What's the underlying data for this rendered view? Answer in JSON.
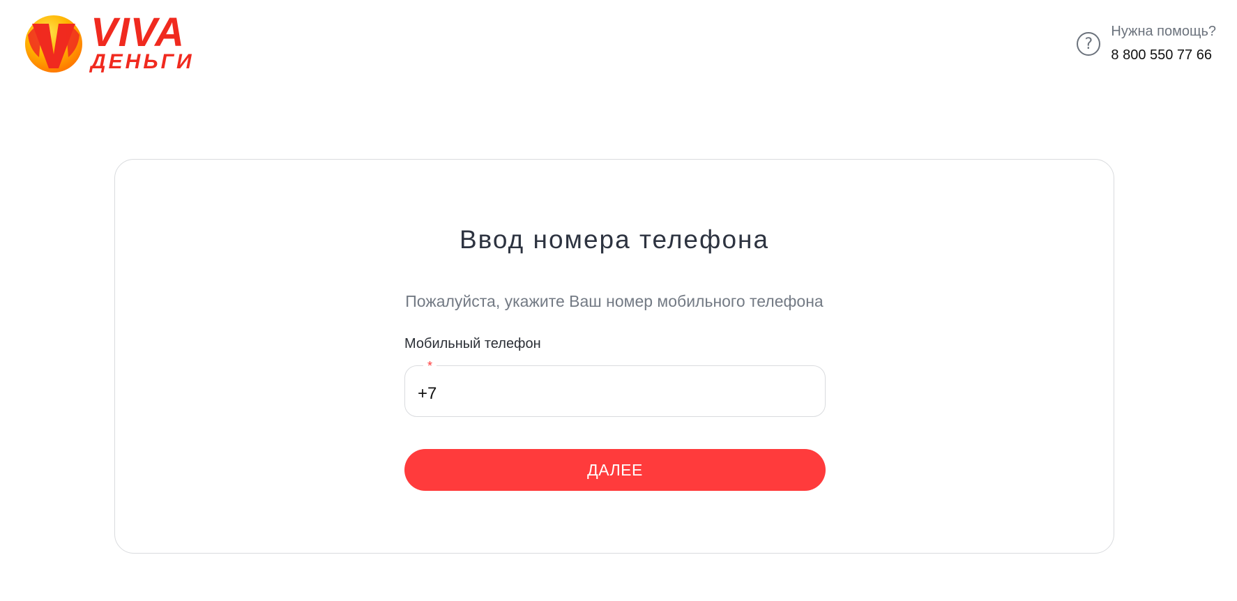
{
  "brand": {
    "line1": "VIVA",
    "line2": "ДЕНЬГИ",
    "colors": {
      "red": "#f02a1f",
      "orange": "#ff8c00",
      "yellow": "#ffd000"
    }
  },
  "help": {
    "icon": "question-circle-icon",
    "title": "Нужна помощь?",
    "phone": "8 800 550 77 66"
  },
  "form": {
    "title": "Ввод номера телефона",
    "subtitle": "Пожалуйста, укажите Ваш номер мобильного телефона",
    "phone_label": "Мобильный телефон",
    "required_mark": "*",
    "phone_value": "+7",
    "submit_label": "ДАЛЕЕ",
    "accent_color": "#ff3b3c"
  }
}
